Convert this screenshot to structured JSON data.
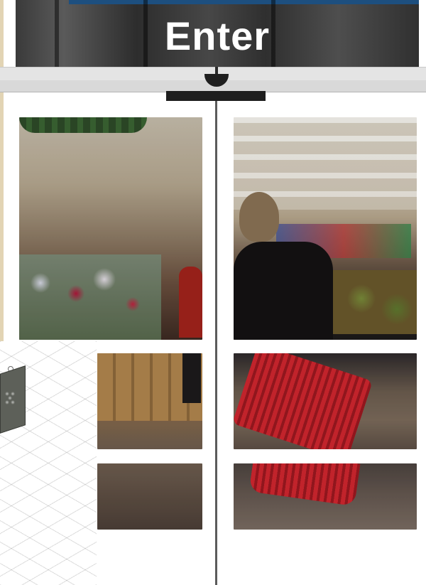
{
  "header": {
    "enter_label": "Enter"
  },
  "colors": {
    "header_band": "#1d4f7f",
    "edge_strip": "#e2d4b4",
    "door_frame": "#e4e4e4",
    "handle": "#1e1e1e",
    "basket_red": "#d2262f"
  },
  "tiles": [
    {
      "name": "flower-aisle-photo",
      "subject": "flower-aisle"
    },
    {
      "name": "shopper-photo",
      "subject": "shopper-with-basket"
    },
    {
      "name": "crates-photo",
      "subject": "crates"
    },
    {
      "name": "basket-photo",
      "subject": "red-basket"
    },
    {
      "name": "floor-photo-left",
      "subject": "floor"
    },
    {
      "name": "floor-photo-right",
      "subject": "floor"
    }
  ],
  "icons": [
    "door-sensor-icon",
    "blueprint-device-icon"
  ]
}
